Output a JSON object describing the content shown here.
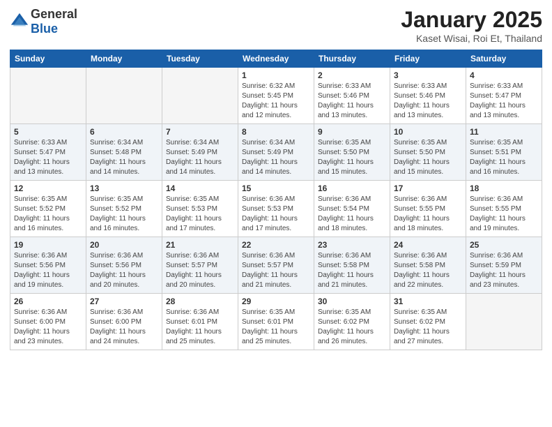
{
  "header": {
    "logo_general": "General",
    "logo_blue": "Blue",
    "month_title": "January 2025",
    "location": "Kaset Wisai, Roi Et, Thailand"
  },
  "weekdays": [
    "Sunday",
    "Monday",
    "Tuesday",
    "Wednesday",
    "Thursday",
    "Friday",
    "Saturday"
  ],
  "weeks": [
    [
      {
        "day": "",
        "info": ""
      },
      {
        "day": "",
        "info": ""
      },
      {
        "day": "",
        "info": ""
      },
      {
        "day": "1",
        "info": "Sunrise: 6:32 AM\nSunset: 5:45 PM\nDaylight: 11 hours\nand 12 minutes."
      },
      {
        "day": "2",
        "info": "Sunrise: 6:33 AM\nSunset: 5:46 PM\nDaylight: 11 hours\nand 13 minutes."
      },
      {
        "day": "3",
        "info": "Sunrise: 6:33 AM\nSunset: 5:46 PM\nDaylight: 11 hours\nand 13 minutes."
      },
      {
        "day": "4",
        "info": "Sunrise: 6:33 AM\nSunset: 5:47 PM\nDaylight: 11 hours\nand 13 minutes."
      }
    ],
    [
      {
        "day": "5",
        "info": "Sunrise: 6:33 AM\nSunset: 5:47 PM\nDaylight: 11 hours\nand 13 minutes."
      },
      {
        "day": "6",
        "info": "Sunrise: 6:34 AM\nSunset: 5:48 PM\nDaylight: 11 hours\nand 14 minutes."
      },
      {
        "day": "7",
        "info": "Sunrise: 6:34 AM\nSunset: 5:49 PM\nDaylight: 11 hours\nand 14 minutes."
      },
      {
        "day": "8",
        "info": "Sunrise: 6:34 AM\nSunset: 5:49 PM\nDaylight: 11 hours\nand 14 minutes."
      },
      {
        "day": "9",
        "info": "Sunrise: 6:35 AM\nSunset: 5:50 PM\nDaylight: 11 hours\nand 15 minutes."
      },
      {
        "day": "10",
        "info": "Sunrise: 6:35 AM\nSunset: 5:50 PM\nDaylight: 11 hours\nand 15 minutes."
      },
      {
        "day": "11",
        "info": "Sunrise: 6:35 AM\nSunset: 5:51 PM\nDaylight: 11 hours\nand 16 minutes."
      }
    ],
    [
      {
        "day": "12",
        "info": "Sunrise: 6:35 AM\nSunset: 5:52 PM\nDaylight: 11 hours\nand 16 minutes."
      },
      {
        "day": "13",
        "info": "Sunrise: 6:35 AM\nSunset: 5:52 PM\nDaylight: 11 hours\nand 16 minutes."
      },
      {
        "day": "14",
        "info": "Sunrise: 6:35 AM\nSunset: 5:53 PM\nDaylight: 11 hours\nand 17 minutes."
      },
      {
        "day": "15",
        "info": "Sunrise: 6:36 AM\nSunset: 5:53 PM\nDaylight: 11 hours\nand 17 minutes."
      },
      {
        "day": "16",
        "info": "Sunrise: 6:36 AM\nSunset: 5:54 PM\nDaylight: 11 hours\nand 18 minutes."
      },
      {
        "day": "17",
        "info": "Sunrise: 6:36 AM\nSunset: 5:55 PM\nDaylight: 11 hours\nand 18 minutes."
      },
      {
        "day": "18",
        "info": "Sunrise: 6:36 AM\nSunset: 5:55 PM\nDaylight: 11 hours\nand 19 minutes."
      }
    ],
    [
      {
        "day": "19",
        "info": "Sunrise: 6:36 AM\nSunset: 5:56 PM\nDaylight: 11 hours\nand 19 minutes."
      },
      {
        "day": "20",
        "info": "Sunrise: 6:36 AM\nSunset: 5:56 PM\nDaylight: 11 hours\nand 20 minutes."
      },
      {
        "day": "21",
        "info": "Sunrise: 6:36 AM\nSunset: 5:57 PM\nDaylight: 11 hours\nand 20 minutes."
      },
      {
        "day": "22",
        "info": "Sunrise: 6:36 AM\nSunset: 5:57 PM\nDaylight: 11 hours\nand 21 minutes."
      },
      {
        "day": "23",
        "info": "Sunrise: 6:36 AM\nSunset: 5:58 PM\nDaylight: 11 hours\nand 21 minutes."
      },
      {
        "day": "24",
        "info": "Sunrise: 6:36 AM\nSunset: 5:58 PM\nDaylight: 11 hours\nand 22 minutes."
      },
      {
        "day": "25",
        "info": "Sunrise: 6:36 AM\nSunset: 5:59 PM\nDaylight: 11 hours\nand 23 minutes."
      }
    ],
    [
      {
        "day": "26",
        "info": "Sunrise: 6:36 AM\nSunset: 6:00 PM\nDaylight: 11 hours\nand 23 minutes."
      },
      {
        "day": "27",
        "info": "Sunrise: 6:36 AM\nSunset: 6:00 PM\nDaylight: 11 hours\nand 24 minutes."
      },
      {
        "day": "28",
        "info": "Sunrise: 6:36 AM\nSunset: 6:01 PM\nDaylight: 11 hours\nand 25 minutes."
      },
      {
        "day": "29",
        "info": "Sunrise: 6:35 AM\nSunset: 6:01 PM\nDaylight: 11 hours\nand 25 minutes."
      },
      {
        "day": "30",
        "info": "Sunrise: 6:35 AM\nSunset: 6:02 PM\nDaylight: 11 hours\nand 26 minutes."
      },
      {
        "day": "31",
        "info": "Sunrise: 6:35 AM\nSunset: 6:02 PM\nDaylight: 11 hours\nand 27 minutes."
      },
      {
        "day": "",
        "info": ""
      }
    ]
  ]
}
